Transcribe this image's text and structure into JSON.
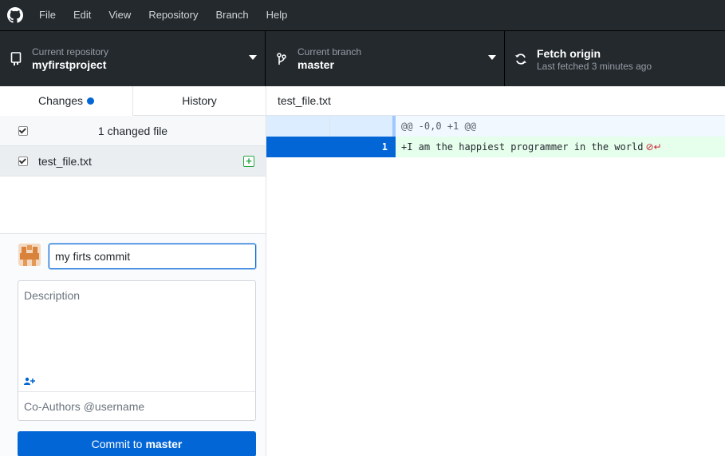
{
  "menu": {
    "items": [
      "File",
      "Edit",
      "View",
      "Repository",
      "Branch",
      "Help"
    ]
  },
  "toolbar": {
    "repo_label": "Current repository",
    "repo_value": "myfirstproject",
    "branch_label": "Current branch",
    "branch_value": "master",
    "fetch_title": "Fetch origin",
    "fetch_status": "Last fetched 3 minutes ago"
  },
  "sidebar": {
    "tab_changes": "Changes",
    "tab_history": "History",
    "changes_count": "1 changed file",
    "files": [
      {
        "name": "test_file.txt",
        "status": "added"
      }
    ]
  },
  "commit": {
    "summary_value": "my firts commit",
    "description_placeholder": "Description",
    "coauthors_placeholder": "Co-Authors @username",
    "button_prefix": "Commit to",
    "button_branch": "master"
  },
  "diff": {
    "filename": "test_file.txt",
    "hunk_header": "@@ -0,0 +1 @@",
    "line_number": "1",
    "line_content": "+I am the happiest programmer in the world"
  },
  "colors": {
    "titlebar": "#24292e",
    "accent_blue": "#0366d6",
    "added_green": "#28a745",
    "added_bg": "#e6ffed",
    "hunk_bg": "#f1f8ff"
  }
}
